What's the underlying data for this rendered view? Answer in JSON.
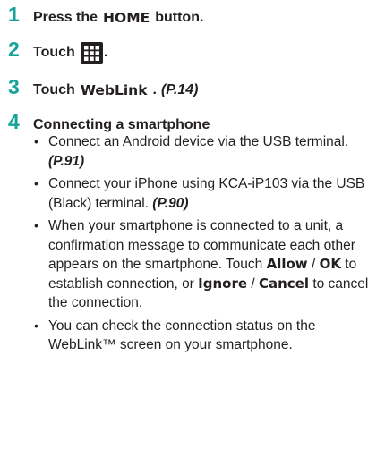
{
  "steps": [
    {
      "num": "1",
      "pre": "Press the",
      "key": "HOME",
      "post": "button."
    },
    {
      "num": "2",
      "pre": "Touch",
      "icon": "grid-menu-icon",
      "post": "."
    },
    {
      "num": "3",
      "pre": "Touch",
      "key": "WebLink",
      "post": ".",
      "ref": "(P.14)"
    },
    {
      "num": "4",
      "title": "Connecting a smartphone"
    }
  ],
  "bullets": {
    "b1": {
      "text": "Connect an Android device via the USB terminal.",
      "ref": "(P.91)"
    },
    "b2": {
      "text": "Connect your iPhone using KCA-iP103 via the USB (Black) terminal.",
      "ref": "(P.90)"
    },
    "b3": {
      "t1": "When your smartphone is connected to a unit, a confirmation message to communicate each other appears on the smartphone. Touch",
      "k1": "Allow",
      "s1": "/",
      "k2": "OK",
      "t2": "to establish connection, or",
      "k3": "Ignore",
      "s2": "/",
      "k4": "Cancel",
      "t3": "to cancel the connection."
    },
    "b4": {
      "text": "You can check the connection status on the WebLink™ screen on your smartphone."
    }
  },
  "bullet_glyph": "•",
  "colors": {
    "step_number": "#17a39a",
    "text": "#231f20",
    "icon_fill": "#231f20"
  }
}
